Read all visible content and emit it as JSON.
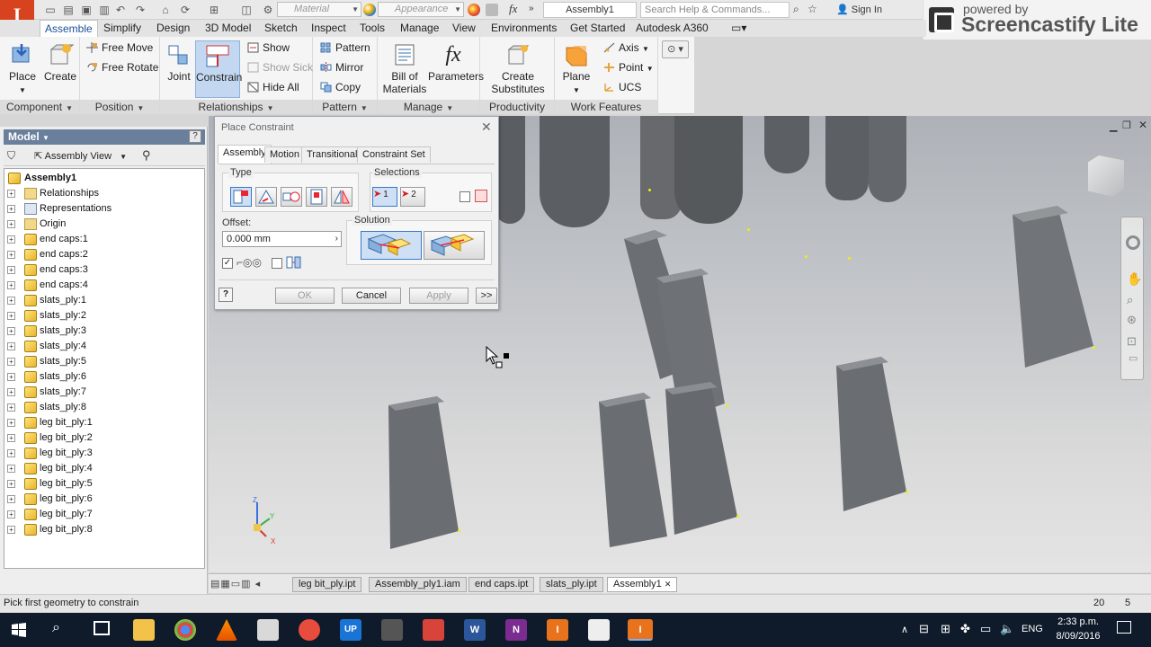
{
  "titlebar": {
    "app_letter": "I",
    "material_placeholder": "Material",
    "appearance_placeholder": "Appearance",
    "fx_label": "fx",
    "document_title": "Assembly1",
    "search_placeholder": "Search Help & Commands...",
    "sign_in": "Sign In",
    "question_icon": "?"
  },
  "banner": {
    "line1": "powered by",
    "line2": "Screencastify Lite"
  },
  "tabs": [
    "Assemble",
    "Simplify",
    "Design",
    "3D Model",
    "Sketch",
    "Inspect",
    "Tools",
    "Manage",
    "View",
    "Environments",
    "Get Started",
    "Autodesk A360"
  ],
  "ribbon": {
    "component": {
      "label": "Component",
      "place": "Place",
      "create": "Create"
    },
    "position": {
      "label": "Position",
      "free_move": "Free Move",
      "free_rotate": "Free Rotate"
    },
    "relationships": {
      "label": "Relationships",
      "joint": "Joint",
      "constrain": "Constrain",
      "show": "Show",
      "show_sick": "Show Sick",
      "hide_all": "Hide All"
    },
    "pattern": {
      "label": "Pattern",
      "pattern": "Pattern",
      "mirror": "Mirror",
      "copy": "Copy"
    },
    "manage": {
      "label": "Manage",
      "bom1": "Bill of",
      "bom2": "Materials",
      "parameters": "Parameters",
      "fx": "fx"
    },
    "productivity": {
      "label": "Productivity",
      "create1": "Create",
      "create2": "Substitutes"
    },
    "work_features": {
      "label": "Work Features",
      "plane": "Plane",
      "axis": "Axis",
      "point": "Point",
      "ucs": "UCS"
    }
  },
  "model": {
    "title": "Model",
    "help": "?",
    "view": "Assembly View",
    "tree": [
      "Assembly1",
      "Relationships",
      "Representations",
      "Origin",
      "end caps:1",
      "end caps:2",
      "end caps:3",
      "end caps:4",
      "slats_ply:1",
      "slats_ply:2",
      "slats_ply:3",
      "slats_ply:4",
      "slats_ply:5",
      "slats_ply:6",
      "slats_ply:7",
      "slats_ply:8",
      "leg bit_ply:1",
      "leg bit_ply:2",
      "leg bit_ply:3",
      "leg bit_ply:4",
      "leg bit_ply:5",
      "leg bit_ply:6",
      "leg bit_ply:7",
      "leg bit_ply:8"
    ]
  },
  "dialog": {
    "title": "Place Constraint",
    "tabs": [
      "Assembly",
      "Motion",
      "Transitional",
      "Constraint Set"
    ],
    "type_label": "Type",
    "selections_label": "Selections",
    "sel1": "1",
    "sel2": "2",
    "offset_label": "Offset:",
    "offset_value": "0.000 mm",
    "solution_label": "Solution",
    "help": "?",
    "ok": "OK",
    "cancel": "Cancel",
    "apply": "Apply",
    "more": ">>",
    "preview_checked": "✓"
  },
  "document_tabs": [
    "leg bit_ply.ipt",
    "Assembly_ply1.iam",
    "end caps.ipt",
    "slats_ply.ipt",
    "Assembly1"
  ],
  "status": {
    "message": "Pick first geometry to constrain",
    "num1": "20",
    "num2": "5"
  },
  "taskbar": {
    "lang": "ENG",
    "time": "2:33 p.m.",
    "date": "8/09/2016"
  },
  "axis": {
    "x": "X",
    "y": "Y",
    "z": "Z"
  }
}
